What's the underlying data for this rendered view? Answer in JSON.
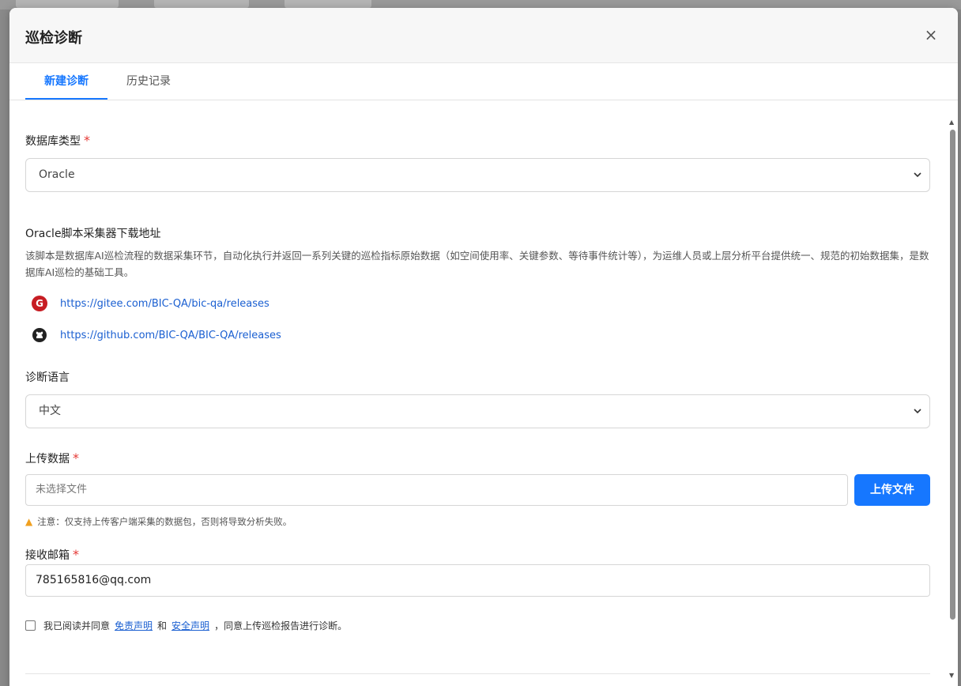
{
  "modal": {
    "title": "巡检诊断",
    "close_icon": "×"
  },
  "tabs": [
    {
      "label": "新建诊断",
      "active": true
    },
    {
      "label": "历史记录",
      "active": false
    }
  ],
  "db_type": {
    "label": "数据库类型",
    "required_mark": "*",
    "value": "Oracle"
  },
  "collector": {
    "title": "Oracle脚本采集器下载地址",
    "description": "该脚本是数据库AI巡检流程的数据采集环节，自动化执行并返回一系列关键的巡检指标原始数据（如空间使用率、关键参数、等待事件统计等），为运维人员或上层分析平台提供统一、规范的初始数据集，是数据库AI巡检的基础工具。",
    "gitee_icon": "G",
    "gitee_url": "https://gitee.com/BIC-QA/bic-qa/releases",
    "github_url": "https://github.com/BIC-QA/BIC-QA/releases"
  },
  "language": {
    "label": "诊断语言",
    "value": "中文"
  },
  "upload": {
    "label": "上传数据",
    "required_mark": "*",
    "placeholder": "未选择文件",
    "button": "上传文件",
    "note": "注意：仅支持上传客户端采集的数据包，否则将导致分析失败。"
  },
  "email": {
    "label": "接收邮箱",
    "required_mark": "*",
    "value": "785165816@qq.com"
  },
  "agreement": {
    "prefix": "我已阅读并同意",
    "link1": "免责声明",
    "and": "和",
    "link2": "安全声明",
    "suffix": "，同意上传巡检报告进行诊断。"
  },
  "colors": {
    "accent": "#1677ff",
    "link": "#1a5fd1",
    "required": "#e53935",
    "gitee": "#c71d23"
  }
}
